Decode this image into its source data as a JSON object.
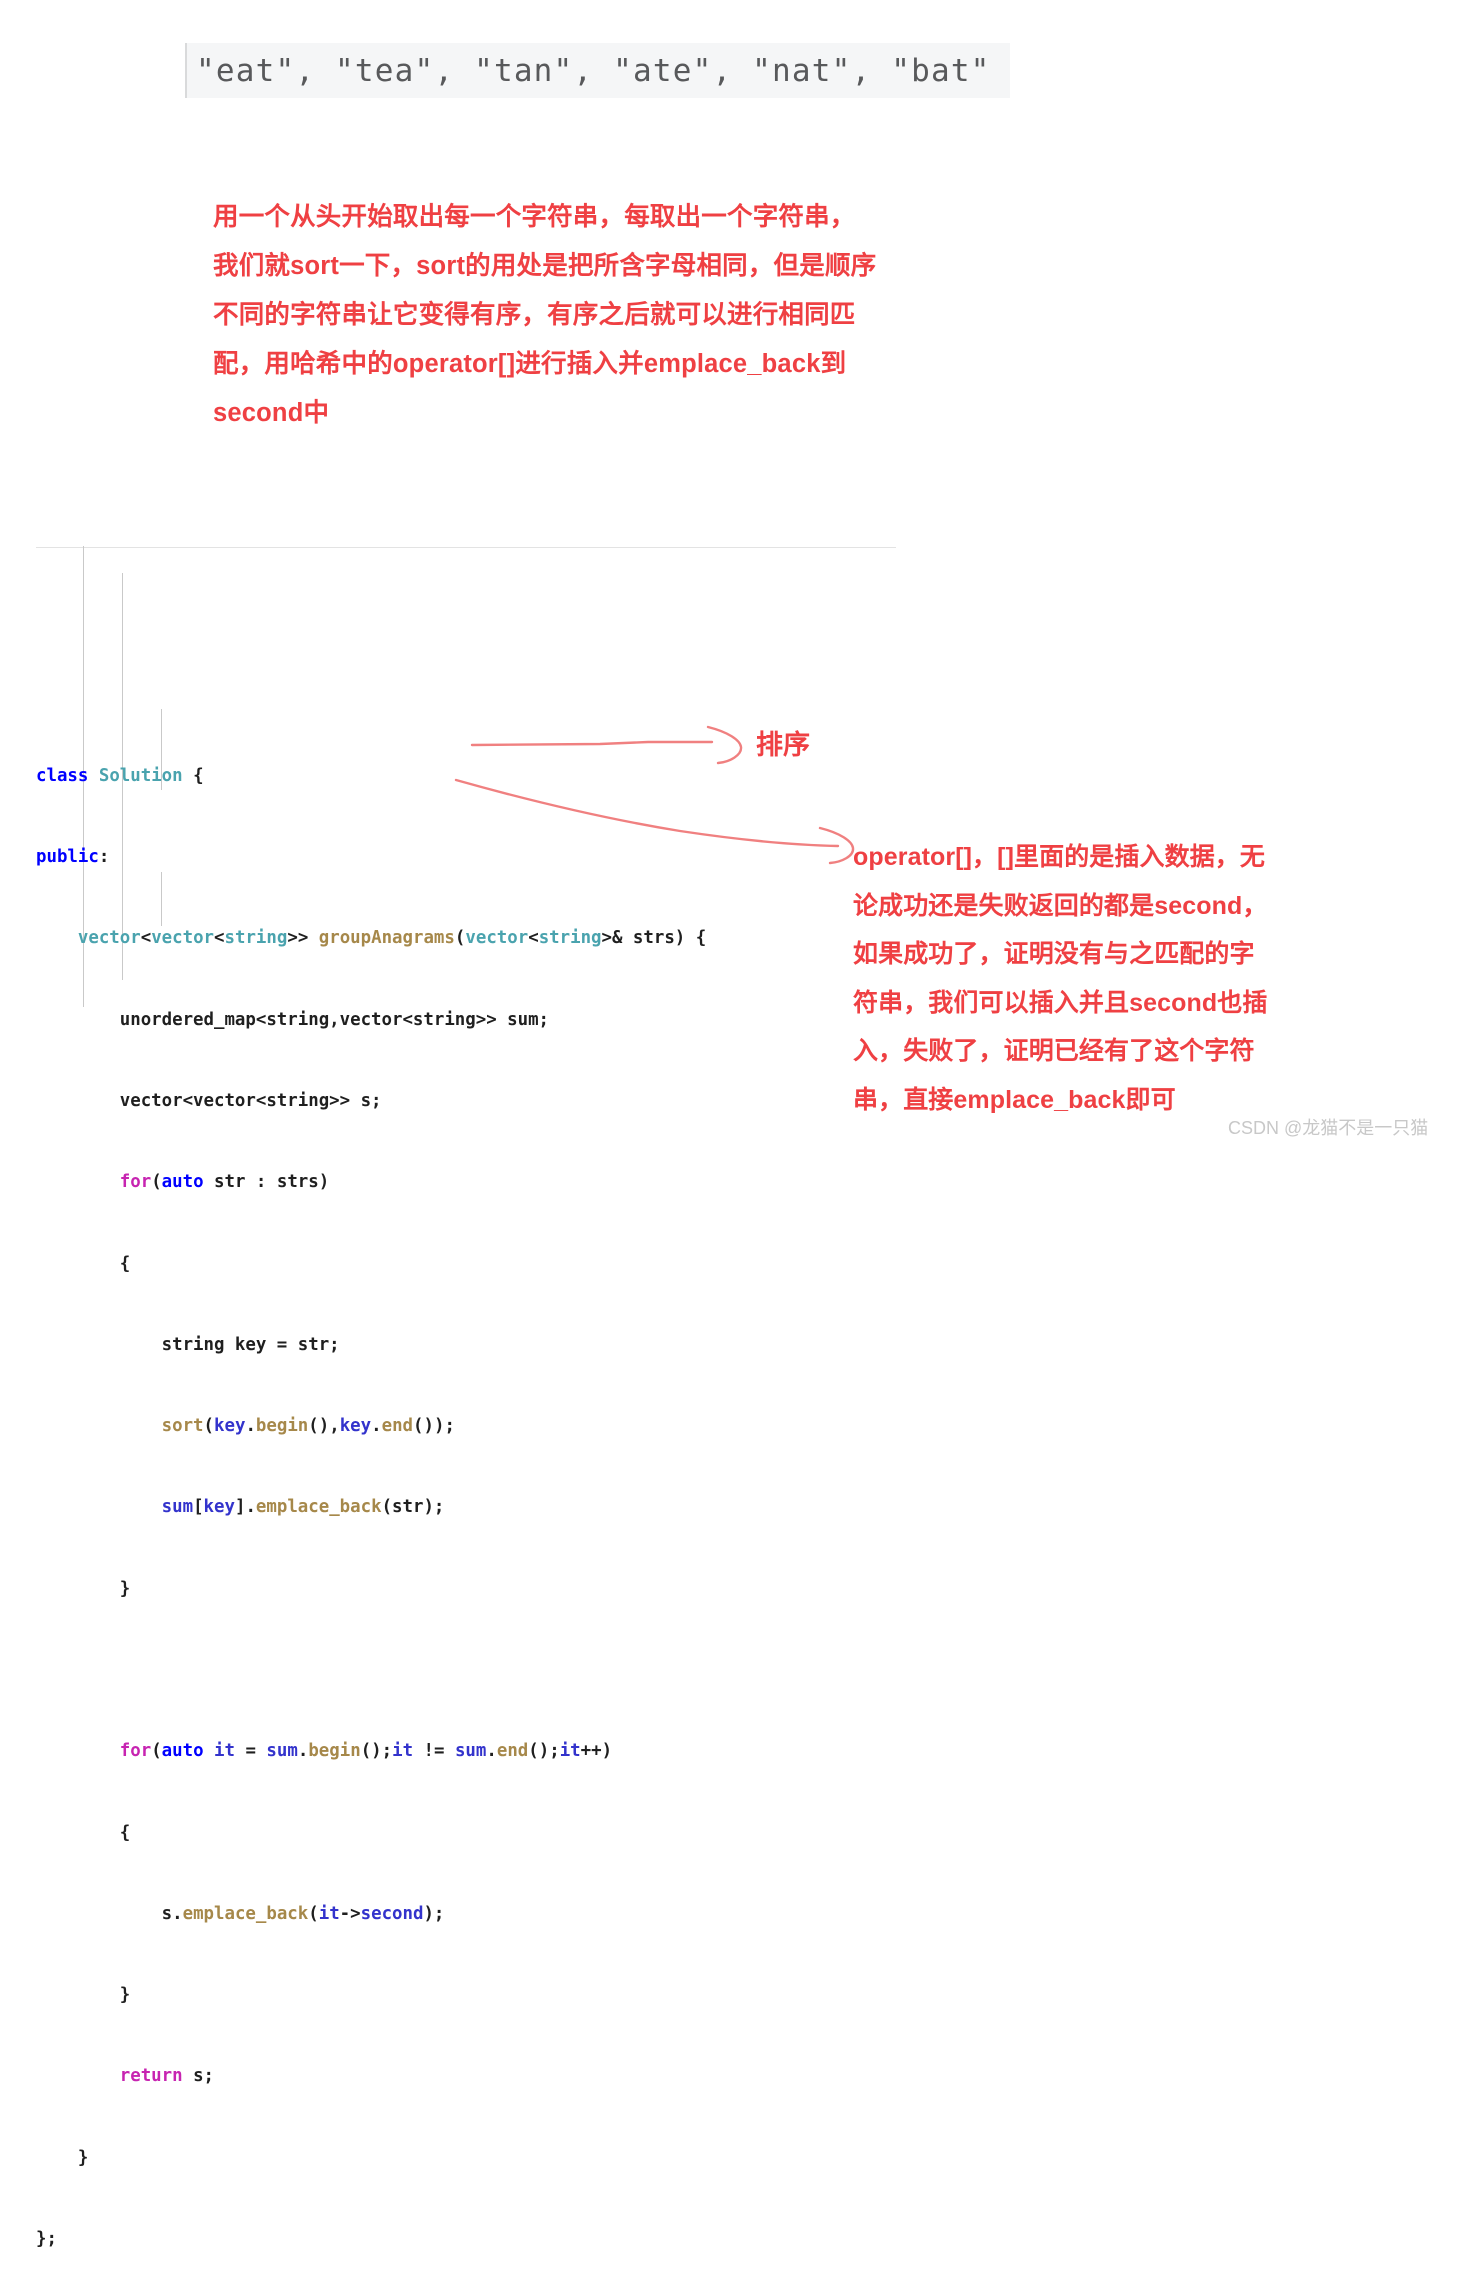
{
  "input_strip": {
    "text": "\"eat\", \"tea\", \"tan\", \"ate\", \"nat\", \"bat\"",
    "background_color": "#f5f6f7",
    "text_color": "#58595b"
  },
  "note_top": {
    "color": "#ef4043",
    "lines": [
      "用一个从头开始取出每一个字符串，每取出一个字符串，",
      "我们就sort一下，sort的用处是把所含字母相同，但是顺序",
      "不同的字符串让它变得有序，有序之后就可以进行相同匹",
      "配，用哈希中的operator[]进行插入并emplace_back到",
      "second中"
    ]
  },
  "code": {
    "language": "cpp",
    "colors": {
      "keyword": "#0000ff",
      "keyword_control": "#c724b1",
      "type": "#4aa3ae",
      "function": "#a6884a",
      "identifier": "#3333cc",
      "plain": "#1f1f1f"
    },
    "lines": [
      "class Solution {",
      "public:",
      "    vector<vector<string>> groupAnagrams(vector<string>& strs) {",
      "        unordered_map<string,vector<string>> sum;",
      "        vector<vector<string>> s;",
      "        for(auto str : strs)",
      "        {",
      "            string key = str;",
      "            sort(key.begin(),key.end());",
      "            sum[key].emplace_back(str);",
      "        }",
      "",
      "        for(auto it = sum.begin();it != sum.end();it++)",
      "        {",
      "            s.emplace_back(it->second);",
      "        }",
      "        return s;",
      "    }",
      "};"
    ]
  },
  "annotation_sort": {
    "text": "排序",
    "color": "#ef4043"
  },
  "note_right": {
    "color": "#ef4043",
    "lines": [
      "operator[]，[]里面的是插入数据，无",
      "论成功还是失败返回的都是second，",
      "如果成功了，证明没有与之匹配的字",
      "符串，我们可以插入并且second也插",
      "入，失败了，证明已经有了这个字符",
      "串，直接emplace_back即可"
    ]
  },
  "watermark": {
    "text": "CSDN @龙猫不是一只猫",
    "color": "#c8c8c8"
  }
}
